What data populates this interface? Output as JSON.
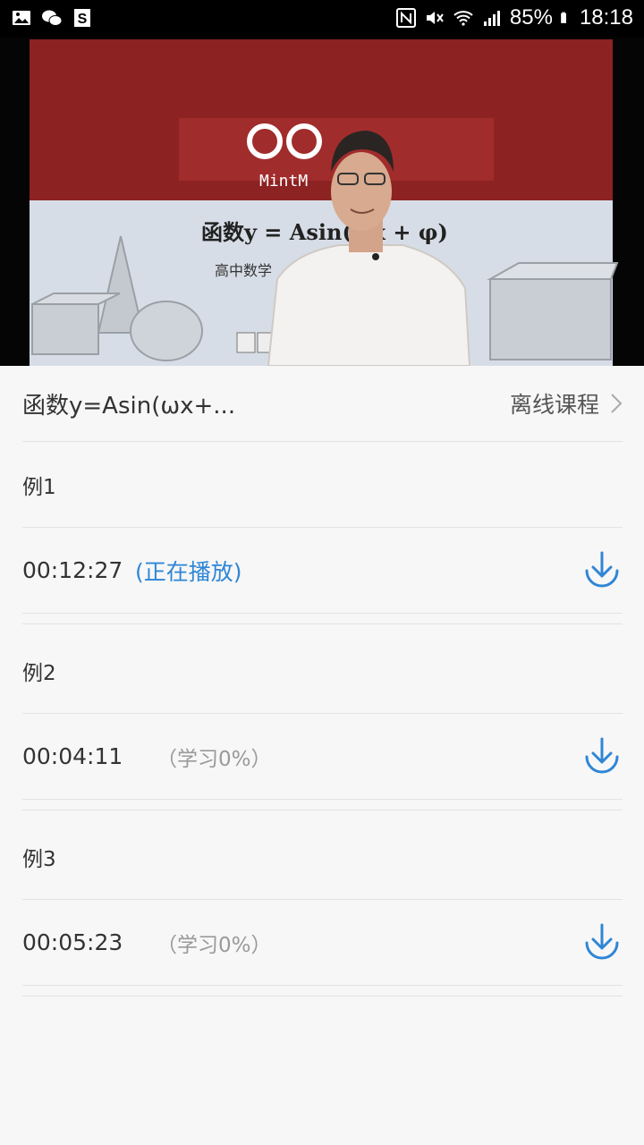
{
  "status_bar": {
    "battery": "85%",
    "time": "18:18"
  },
  "video": {
    "slide_title": "函数y = Asin(ωx + φ)",
    "slide_subtitle": "高中数学",
    "logo_text": "MintM"
  },
  "course": {
    "title": "函数y=Asin(ωx+...",
    "offline_label": "离线课程"
  },
  "lessons": [
    {
      "section": "例1",
      "duration": "00:12:27",
      "status": "(正在播放)"
    },
    {
      "section": "例2",
      "duration": "00:04:11",
      "status": "（学习0%）"
    },
    {
      "section": "例3",
      "duration": "00:05:23",
      "status": "（学习0%）"
    }
  ],
  "colors": {
    "accent": "#2f86d6",
    "background": "#f7f7f7"
  }
}
